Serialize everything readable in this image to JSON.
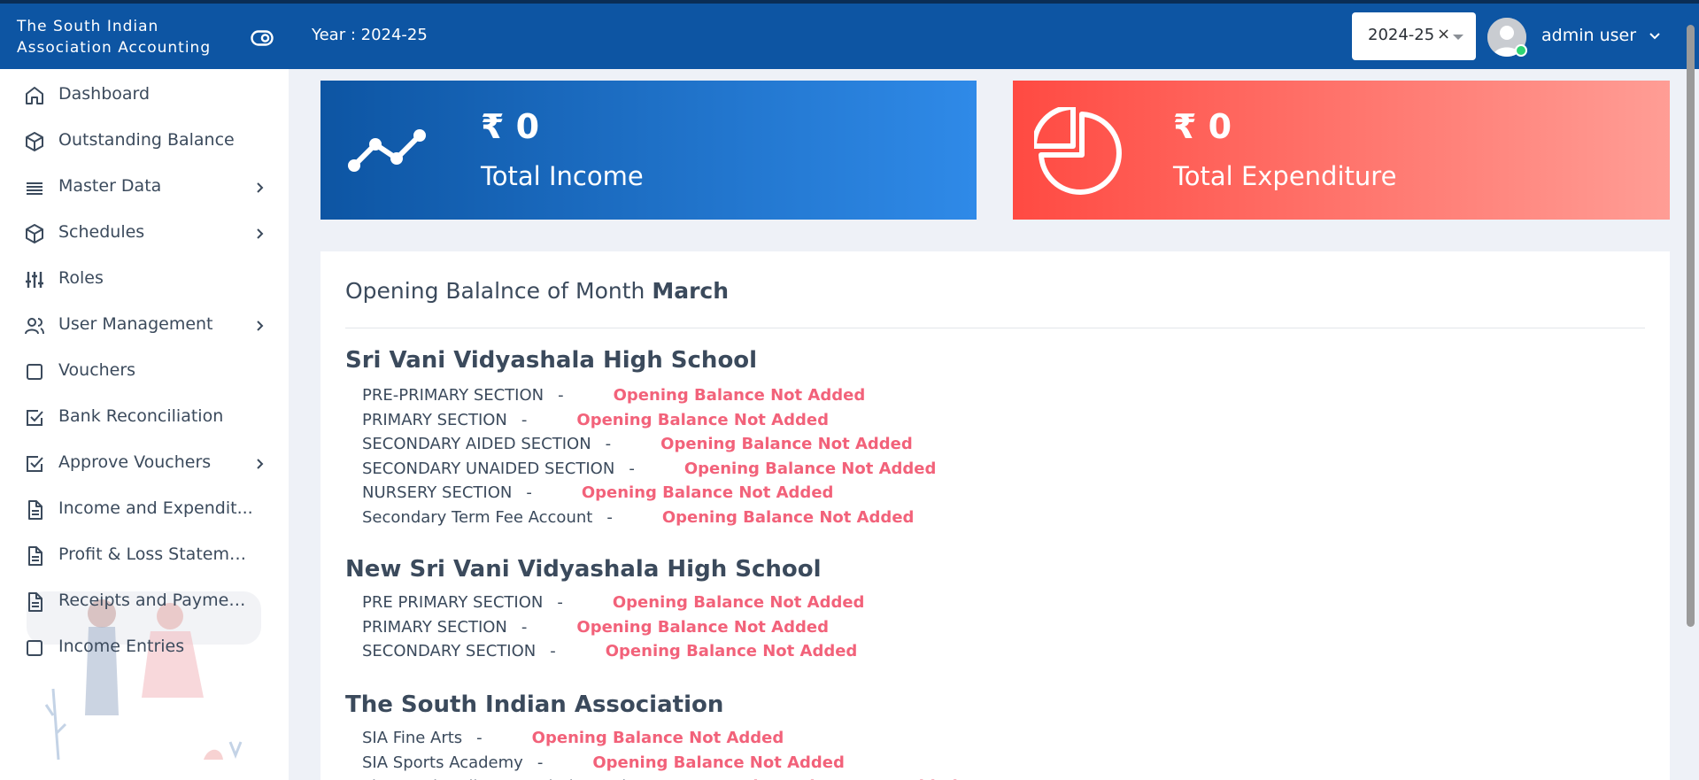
{
  "header": {
    "brand": "The South Indian Association Accounting",
    "year_label": "Year : 2024-25",
    "year_select_value": "2024-25",
    "year_select_clear": "×",
    "user_name": "admin user",
    "colors": {
      "bar": "#0d55a3",
      "online": "#2ed573"
    }
  },
  "sidebar": {
    "items": [
      {
        "label": "Dashboard",
        "icon": "home-icon",
        "has_children": false
      },
      {
        "label": "Outstanding Balance",
        "icon": "box-icon",
        "has_children": false
      },
      {
        "label": "Master Data",
        "icon": "list-icon",
        "has_children": true
      },
      {
        "label": "Schedules",
        "icon": "box-icon",
        "has_children": true
      },
      {
        "label": "Roles",
        "icon": "sliders-icon",
        "has_children": false
      },
      {
        "label": "User Management",
        "icon": "users-icon",
        "has_children": true
      },
      {
        "label": "Vouchers",
        "icon": "square-icon",
        "has_children": false
      },
      {
        "label": "Bank Reconciliation",
        "icon": "check-square-icon",
        "has_children": false
      },
      {
        "label": "Approve Vouchers",
        "icon": "check-square-icon",
        "has_children": true
      },
      {
        "label": "Income and Expendit...",
        "icon": "file-text-icon",
        "has_children": false
      },
      {
        "label": "Profit & Loss Stateme...",
        "icon": "file-text-icon",
        "has_children": false
      },
      {
        "label": "Receipts and Paymen...",
        "icon": "file-text-icon",
        "has_children": false
      },
      {
        "label": "Income Entries",
        "icon": "square-icon",
        "has_children": false
      }
    ]
  },
  "cards": {
    "income": {
      "amount": "₹ 0",
      "title": "Total Income",
      "icon": "trend-line-icon"
    },
    "expenditure": {
      "amount": "₹ 0",
      "title": "Total Expenditure",
      "icon": "pie-chart-icon"
    }
  },
  "panel": {
    "heading_prefix": "Opening Balalnce of Month",
    "heading_month": "March",
    "schools": [
      {
        "name": "Sri Vani Vidyashala High School",
        "sections": [
          {
            "name": "PRE-PRIMARY SECTION",
            "status": "Opening Balance Not Added"
          },
          {
            "name": "PRIMARY SECTION",
            "status": "Opening Balance Not Added"
          },
          {
            "name": "SECONDARY AIDED SECTION",
            "status": "Opening Balance Not Added"
          },
          {
            "name": "SECONDARY UNAIDED SECTION",
            "status": "Opening Balance Not Added"
          },
          {
            "name": "NURSERY SECTION",
            "status": "Opening Balance Not Added"
          },
          {
            "name": "Secondary Term Fee Account",
            "status": "Opening Balance Not Added"
          }
        ]
      },
      {
        "name": "New Sri Vani Vidyashala High School",
        "sections": [
          {
            "name": "PRE PRIMARY SECTION",
            "status": "Opening Balance Not Added"
          },
          {
            "name": "PRIMARY SECTION",
            "status": "Opening Balance Not Added"
          },
          {
            "name": "SECONDARY SECTION",
            "status": "Opening Balance Not Added"
          }
        ]
      },
      {
        "name": "The South Indian Association",
        "sections": [
          {
            "name": "SIA Fine Arts",
            "status": "Opening Balance Not Added"
          },
          {
            "name": "SIA Sports Academy",
            "status": "Opening Balance Not Added"
          },
          {
            "name": "The South Indian Association Main",
            "status": "Opening Balance Not Added"
          }
        ]
      }
    ],
    "separator": "-",
    "status_color": "#f2627a"
  }
}
